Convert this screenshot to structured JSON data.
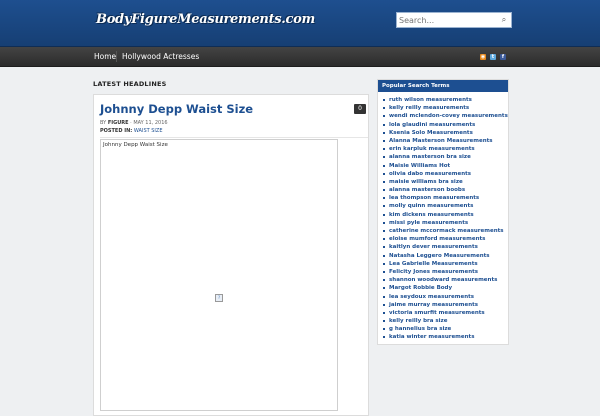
{
  "site": {
    "logo_text": "BodyFigureMeasurements.com"
  },
  "search": {
    "placeholder": "Search..."
  },
  "nav": {
    "items": [
      {
        "label": "Home"
      },
      {
        "label": "Hollywood Actresses"
      }
    ],
    "social_icons": [
      "rss-icon",
      "twitter-icon",
      "facebook-icon"
    ]
  },
  "main": {
    "section_title": "LATEST HEADLINES",
    "post": {
      "title": "Johnny Depp Waist Size",
      "comments": "0",
      "by_label": "BY",
      "author": "FIGURE",
      "date": "MAY 11, 2016",
      "posted_in_label": "POSTED IN:",
      "category": "WAIST SIZE",
      "image_caption": "Johnny Depp Waist Size"
    }
  },
  "sidebar": {
    "title": "Popular Search Terms",
    "terms": [
      "ruth wilson measurements",
      "kelly reilly measurements",
      "wendi mclendon-covey measurements",
      "lola glaudini measurements",
      "Ksenia Solo Measurements",
      "Alanna Masterson Measurements",
      "erin karpluk measurements",
      "alanna masterson bra size",
      "Maisie Williams Hot",
      "olivia dabo measurements",
      "maisie williams bra size",
      "alanna masterson boobs",
      "lea thompson measurements",
      "molly quinn measurements",
      "kim dickens measurements",
      "missi pyle measurements",
      "catherine mccormack measurements",
      "eloise mumford measurements",
      "kaitlyn dever measurements",
      "Natasha Leggero Measurements",
      "Lea Gabrielle Measurements",
      "Felicity Jones measurements",
      "shannon woodward measurements",
      "Margot Robbie Body",
      "lea seydoux measurements",
      "jaime murray measurements",
      "victoria smurfit measurements",
      "kelly reilly bra size",
      "g hannelius bra size",
      "katia winter measurements"
    ]
  },
  "colors": {
    "header_blue": "#1e4f8f",
    "link_blue": "#1d4f91",
    "nav_dark": "#333333"
  }
}
